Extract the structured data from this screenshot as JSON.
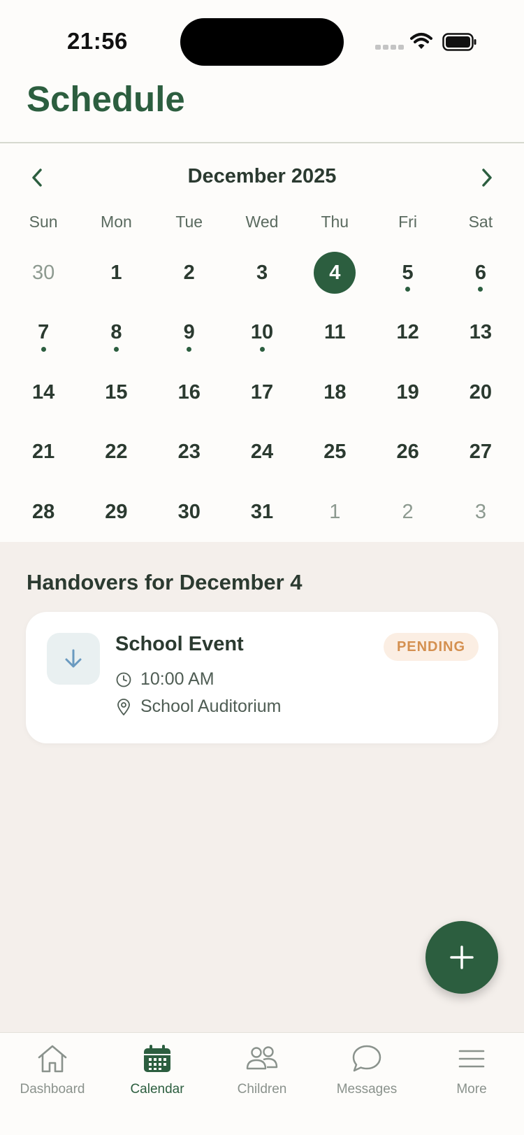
{
  "status_bar": {
    "time": "21:56"
  },
  "header": {
    "title": "Schedule"
  },
  "calendar": {
    "month_label": "December 2025",
    "weekdays": [
      "Sun",
      "Mon",
      "Tue",
      "Wed",
      "Thu",
      "Fri",
      "Sat"
    ],
    "days": [
      {
        "n": "30",
        "muted": true
      },
      {
        "n": "1"
      },
      {
        "n": "2"
      },
      {
        "n": "3"
      },
      {
        "n": "4",
        "selected": true
      },
      {
        "n": "5",
        "dot": true
      },
      {
        "n": "6",
        "dot": true
      },
      {
        "n": "7",
        "dot": true
      },
      {
        "n": "8",
        "dot": true
      },
      {
        "n": "9",
        "dot": true
      },
      {
        "n": "10",
        "dot": true
      },
      {
        "n": "11"
      },
      {
        "n": "12"
      },
      {
        "n": "13"
      },
      {
        "n": "14"
      },
      {
        "n": "15"
      },
      {
        "n": "16"
      },
      {
        "n": "17"
      },
      {
        "n": "18"
      },
      {
        "n": "19"
      },
      {
        "n": "20"
      },
      {
        "n": "21"
      },
      {
        "n": "22"
      },
      {
        "n": "23"
      },
      {
        "n": "24"
      },
      {
        "n": "25"
      },
      {
        "n": "26"
      },
      {
        "n": "27"
      },
      {
        "n": "28"
      },
      {
        "n": "29"
      },
      {
        "n": "30"
      },
      {
        "n": "31"
      },
      {
        "n": "1",
        "muted": true
      },
      {
        "n": "2",
        "muted": true
      },
      {
        "n": "3",
        "muted": true
      }
    ]
  },
  "handovers": {
    "section_title": "Handovers for December 4",
    "items": [
      {
        "title": "School Event",
        "status": "PENDING",
        "time": "10:00 AM",
        "location": "School Auditorium",
        "icon": "arrow-down-icon"
      }
    ]
  },
  "fab": {
    "icon": "plus-icon"
  },
  "tabbar": {
    "tabs": [
      {
        "label": "Dashboard",
        "icon": "home-icon"
      },
      {
        "label": "Calendar",
        "icon": "calendar-icon",
        "active": true
      },
      {
        "label": "Children",
        "icon": "people-icon"
      },
      {
        "label": "Messages",
        "icon": "message-bubble-icon"
      },
      {
        "label": "More",
        "icon": "menu-icon"
      }
    ]
  },
  "colors": {
    "brand": "#2c5e3f",
    "background": "#f4efeb",
    "surface": "#fdfcfa",
    "pending_text": "#d49050",
    "pending_bg": "#fbeee3"
  }
}
